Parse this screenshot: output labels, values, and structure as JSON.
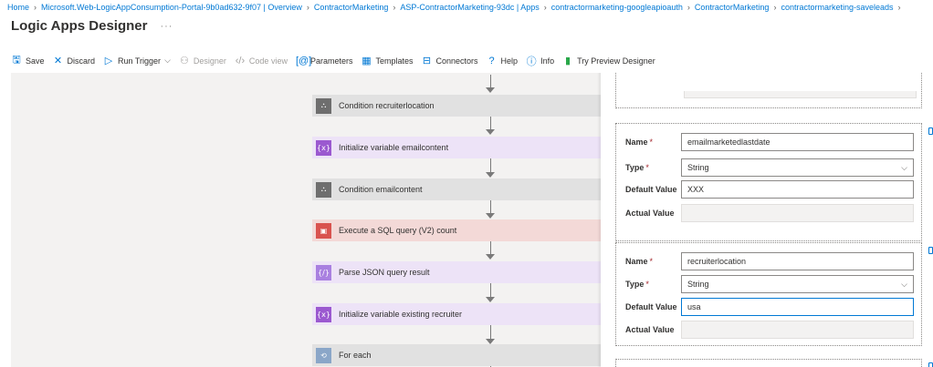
{
  "breadcrumb": [
    "Home",
    "Microsoft.Web-LogicAppConsumption-Portal-9b0ad632-9f07 | Overview",
    "ContractorMarketing",
    "ASP-ContractorMarketing-93dc | Apps",
    "contractormarketing-googleapioauth",
    "ContractorMarketing",
    "contractormarketing-saveleads"
  ],
  "page": {
    "title": "Logic Apps Designer",
    "more": "···"
  },
  "toolbar": {
    "save": "Save",
    "discard": "Discard",
    "run_trigger": "Run Trigger",
    "designer": "Designer",
    "code_view": "Code view",
    "parameters": "Parameters",
    "templates": "Templates",
    "connectors": "Connectors",
    "help": "Help",
    "info": "Info",
    "preview": "Try Preview Designer"
  },
  "steps": [
    {
      "label": "Condition recruiterlocation",
      "icon": "condition-icon",
      "glyph": "⛬"
    },
    {
      "label": "Initialize variable emailcontent",
      "icon": "variable-icon",
      "glyph": "{x}"
    },
    {
      "label": "Condition emailcontent",
      "icon": "condition-icon",
      "glyph": "⛬"
    },
    {
      "label": "Execute a SQL query (V2) count",
      "icon": "sql-icon",
      "glyph": "▣"
    },
    {
      "label": "Parse JSON query result",
      "icon": "json-icon",
      "glyph": "{/}"
    },
    {
      "label": "Initialize variable existing recruiter",
      "icon": "variable-icon",
      "glyph": "{x}"
    },
    {
      "label": "For each",
      "icon": "loop-icon",
      "glyph": "⟲"
    }
  ],
  "params": [
    {
      "name_label": "Name",
      "type_label": "Type",
      "default_label": "Default Value",
      "actual_label": "Actual Value",
      "required": "*",
      "name": "emailmarketedlastdate",
      "type": "String",
      "default": "XXX",
      "actual": ""
    },
    {
      "name_label": "Name",
      "type_label": "Type",
      "default_label": "Default Value",
      "actual_label": "Actual Value",
      "required": "*",
      "name": "recruiterlocation",
      "type": "String",
      "default": "usa",
      "actual": ""
    }
  ],
  "colors": {
    "accent": "#0078d4",
    "condition": "#6e6e6e",
    "variable": "#9b59d0",
    "sql": "#d9534f"
  }
}
